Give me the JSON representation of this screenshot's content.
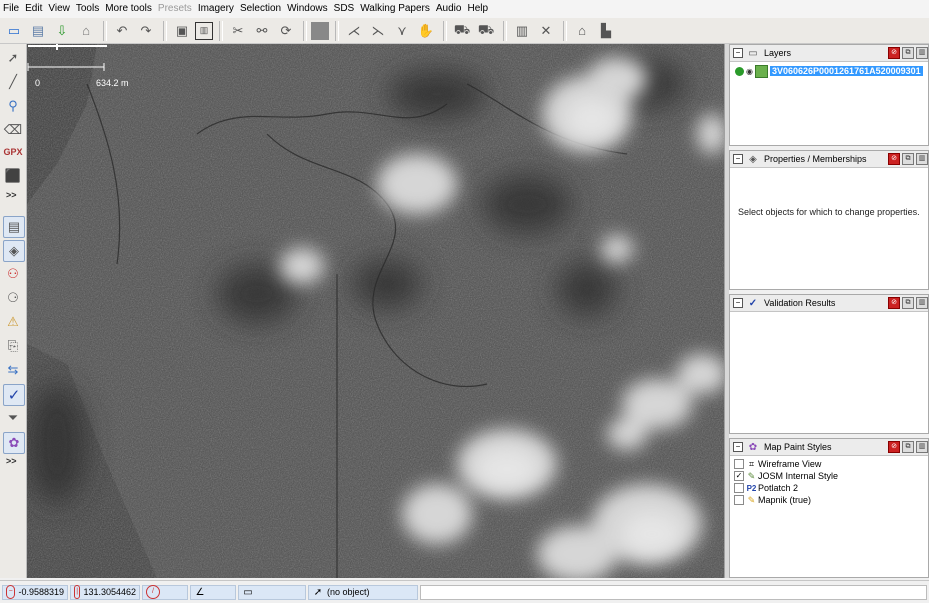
{
  "menu": [
    "File",
    "Edit",
    "View",
    "Tools",
    "More tools",
    "Presets",
    "Imagery",
    "Selection",
    "Windows",
    "SDS",
    "Walking Papers",
    "Audio",
    "Help"
  ],
  "menu_disabled_index": 5,
  "toolbar_icons": [
    "open-file-icon",
    "save-icon",
    "download-icon",
    "upload-icon",
    "sep",
    "undo-icon",
    "redo-icon",
    "sep",
    "copy-icon",
    "paste-tags-icon",
    "sep",
    "split-way-icon",
    "combine-way-icon",
    "refresh-icon",
    "sep",
    "orthogonalize-icon",
    "sep",
    "align-icon",
    "merge-nodes-icon",
    "wireframe-icon",
    "hand-icon",
    "sep",
    "car-icon",
    "car2-icon",
    "sep",
    "table-icon",
    "close-x-icon",
    "sep",
    "factory-icon",
    "building-icon"
  ],
  "left_tools": {
    "group1": [
      "select-icon",
      "draw-icon",
      "zoom-icon",
      "delete-icon",
      "gpx-icon",
      "extrude-icon"
    ],
    "group2": [
      "toggle-dialogs-icon",
      "tags-icon",
      "relation-icon",
      "filter-icon",
      "conflict-icon",
      "history-icon",
      "selection-list-icon",
      "validator-icon",
      "filter-funnel-icon",
      "map-paint-icon"
    ],
    "more_label": ">>"
  },
  "map": {
    "scale_zero": "0",
    "scale_value": "634.2 m"
  },
  "panels": {
    "layers": {
      "title": "Layers",
      "layer_name": "3V060626P0001261761A520009301"
    },
    "properties": {
      "title": "Properties / Memberships",
      "message": "Select objects for which to change properties."
    },
    "validation": {
      "title": "Validation Results"
    },
    "map_paint": {
      "title": "Map Paint Styles",
      "styles": [
        {
          "label": "Wireframe View",
          "checked": false,
          "icon": "wireframe-icon"
        },
        {
          "label": "JOSM Internal Style",
          "checked": true,
          "icon": "josm-style-icon"
        },
        {
          "label": "Potlatch 2",
          "checked": false,
          "icon": "potlatch-icon"
        },
        {
          "label": "Mapnik (true)",
          "checked": false,
          "icon": "mapnik-icon"
        }
      ]
    }
  },
  "status": {
    "lat": "-0.9588319",
    "lon": "131.3054462",
    "selection": "(no object)"
  }
}
